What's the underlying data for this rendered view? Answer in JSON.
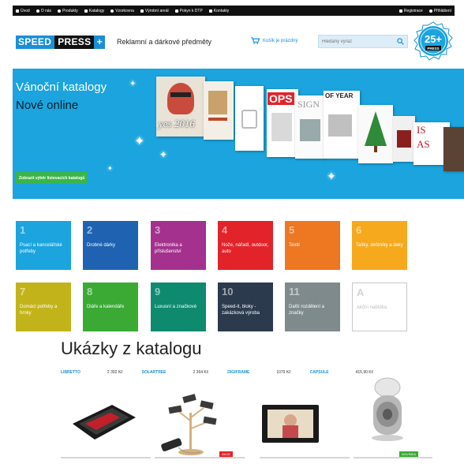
{
  "topbar": {
    "links": [
      "Úvod",
      "O nás",
      "Produkty",
      "Katalogy",
      "Vzorkovna",
      "Výrobní areál",
      "Pokyn k DTP",
      "Kontakty"
    ],
    "register": "Registrace",
    "login": "Přihlášení"
  },
  "header": {
    "logo_speed": "SPEED",
    "logo_press": "PRESS",
    "logo_plus": "+",
    "tagline": "Reklamní a dárkové předměty",
    "cart": "Košík je prázdný",
    "search_placeholder": "Hledaný výraz",
    "badge_number": "25+",
    "badge_brand": "PRESS"
  },
  "banner": {
    "title": "Vánoční katalogy",
    "subtitle": "Nové online",
    "cta": "Zobrazit výběr listovacích katalogů",
    "catalog_covers": [
      "yes 2016",
      "OPS",
      "SIGN",
      "OF YEAR",
      "IS",
      "AS"
    ]
  },
  "categories": [
    {
      "num": "1",
      "label": "Psací a kancelářské potřeby",
      "color": "#1ba4de"
    },
    {
      "num": "2",
      "label": "Drobné dárky",
      "color": "#1f62b2"
    },
    {
      "num": "3",
      "label": "Elektronika a příslušenství",
      "color": "#a4318e"
    },
    {
      "num": "4",
      "label": "Nože, nářadí, outdoor, auto",
      "color": "#e3232a"
    },
    {
      "num": "5",
      "label": "Textil",
      "color": "#ee7722"
    },
    {
      "num": "6",
      "label": "Tašky, deštníky a deky",
      "color": "#f6a91c"
    },
    {
      "num": "7",
      "label": "Domácí potřeby a hrnky",
      "color": "#c2b31b"
    },
    {
      "num": "8",
      "label": "Diáře a kalendáře",
      "color": "#3aaa35"
    },
    {
      "num": "9",
      "label": "Luxusní a značkové",
      "color": "#0e8a6f"
    },
    {
      "num": "10",
      "label": "Speed-it, bloky - zakázková výroba",
      "color": "#2b3a4d"
    },
    {
      "num": "11",
      "label": "Další rozdělení a značky",
      "color": "#7e8a8c"
    },
    {
      "num": "A",
      "label": "Akční nabídka",
      "color": "#ffffff"
    }
  ],
  "samples": {
    "title": "Ukázky z katalogu",
    "products": [
      {
        "name": "LIBRETTO",
        "price": "2 392 Kč"
      },
      {
        "name": "SOLARTREE",
        "price": "2 364 Kč"
      },
      {
        "name": "DIGIFRAME",
        "price": "1079 Kč"
      },
      {
        "name": "CAPSULE",
        "price": "415,90 Kč"
      }
    ],
    "badges": [
      {
        "text": "AKCE",
        "color": "#e3232a"
      },
      {
        "text": "NOVINKA",
        "color": "#3aaa35"
      }
    ]
  }
}
